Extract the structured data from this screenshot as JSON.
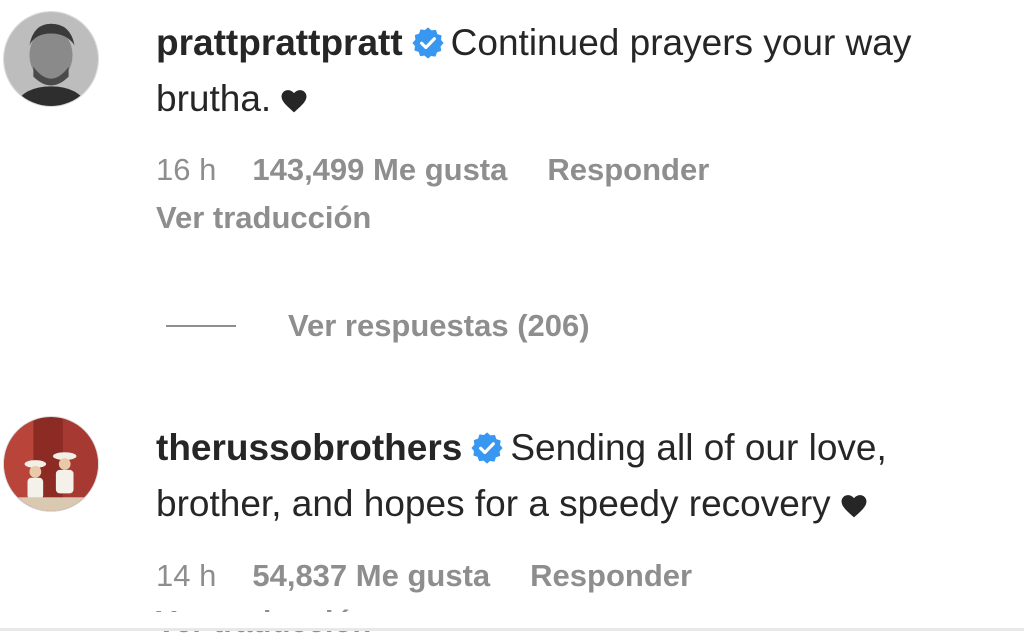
{
  "comments": [
    {
      "username": "prattprattpratt",
      "verified": true,
      "text": "Continued prayers your way brutha.",
      "time": "16 h",
      "likes": "143,499 Me gusta",
      "reply_label": "Responder",
      "translate_label": "Ver traducción"
    },
    {
      "username": "therussobrothers",
      "verified": true,
      "text": "Sending all of our love, brother, and hopes for a speedy recovery",
      "time": "14 h",
      "likes": "54,837 Me gusta",
      "reply_label": "Responder",
      "translate_label": "Ver traducción"
    }
  ],
  "view_replies_label": "Ver respuestas (206)",
  "colors": {
    "text": "#262626",
    "secondary": "#8e8e8e",
    "verified": "#3897f0"
  }
}
